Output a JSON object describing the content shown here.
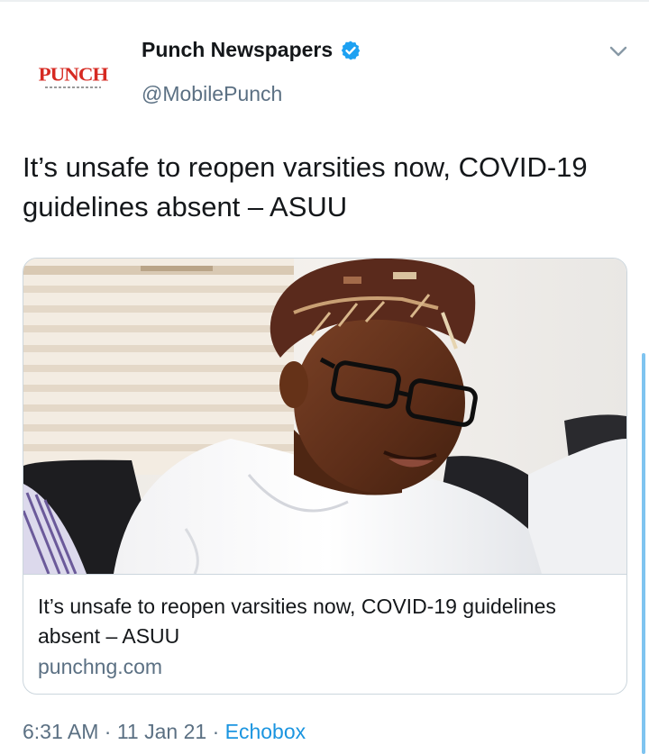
{
  "author": {
    "display_name": "Punch Newspapers",
    "handle": "@MobilePunch",
    "logo_text": "PUNCH",
    "verified": true
  },
  "tweet": {
    "text": "It’s unsafe to reopen varsities now, COVID-19 guidelines absent – ASUU"
  },
  "card": {
    "title": "It’s unsafe to reopen varsities now, COVID-19 guidelines absent – ASUU",
    "domain": "punchng.com",
    "image_subject": "man-in-cap-and-glasses-photo"
  },
  "meta": {
    "time": "6:31 AM",
    "date": "11 Jan 21",
    "separator": "·",
    "source": "Echobox"
  },
  "icons": {
    "verified": "verified-badge-icon",
    "menu": "chevron-down-icon"
  },
  "colors": {
    "accent": "#1b95e0",
    "secondary_text": "#5b7083",
    "brand_red": "#d62a22",
    "border": "#ccd6dd"
  }
}
